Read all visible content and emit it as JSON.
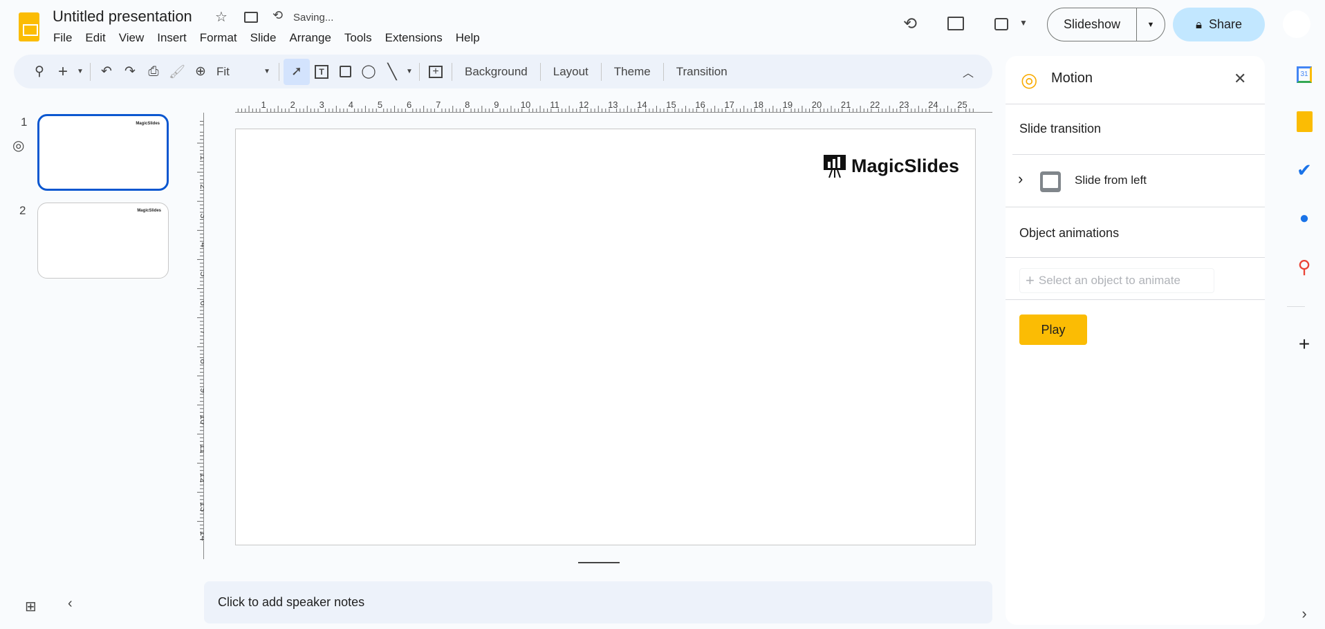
{
  "header": {
    "title": "Untitled presentation",
    "status": "Saving...",
    "menu": [
      "File",
      "Edit",
      "View",
      "Insert",
      "Format",
      "Slide",
      "Arrange",
      "Tools",
      "Extensions",
      "Help"
    ],
    "slideshow_label": "Slideshow",
    "share_label": "Share"
  },
  "toolbar": {
    "zoom_value": "Fit",
    "buttons": [
      "Background",
      "Layout",
      "Theme",
      "Transition"
    ]
  },
  "filmstrip": {
    "slides": [
      {
        "number": "1",
        "logo": "MagicSlides",
        "selected": true
      },
      {
        "number": "2",
        "logo": "MagicSlides",
        "selected": false
      }
    ]
  },
  "ruler": {
    "top": [
      "1",
      "2",
      "3",
      "4",
      "5",
      "6",
      "7",
      "8",
      "9",
      "10",
      "11",
      "12",
      "13",
      "14",
      "15",
      "16",
      "17",
      "18",
      "19",
      "20",
      "21",
      "22",
      "23",
      "24",
      "25"
    ],
    "left": [
      "1",
      "2",
      "3",
      "4",
      "5",
      "6",
      "7",
      "8",
      "9",
      "10",
      "11",
      "12",
      "13",
      "14"
    ]
  },
  "slide": {
    "logo_text": "MagicSlides"
  },
  "notes": {
    "placeholder": "Click to add speaker notes"
  },
  "motion": {
    "title": "Motion",
    "slide_transition_label": "Slide transition",
    "transition_value": "Slide from left",
    "object_animations_label": "Object animations",
    "add_animation_label": "Select an object to animate",
    "play_label": "Play"
  },
  "colors": {
    "accent": "#0b57d0",
    "share_bg": "#c2e7ff",
    "play": "#fbbc04",
    "toolbar_bg": "#edf2fa"
  }
}
